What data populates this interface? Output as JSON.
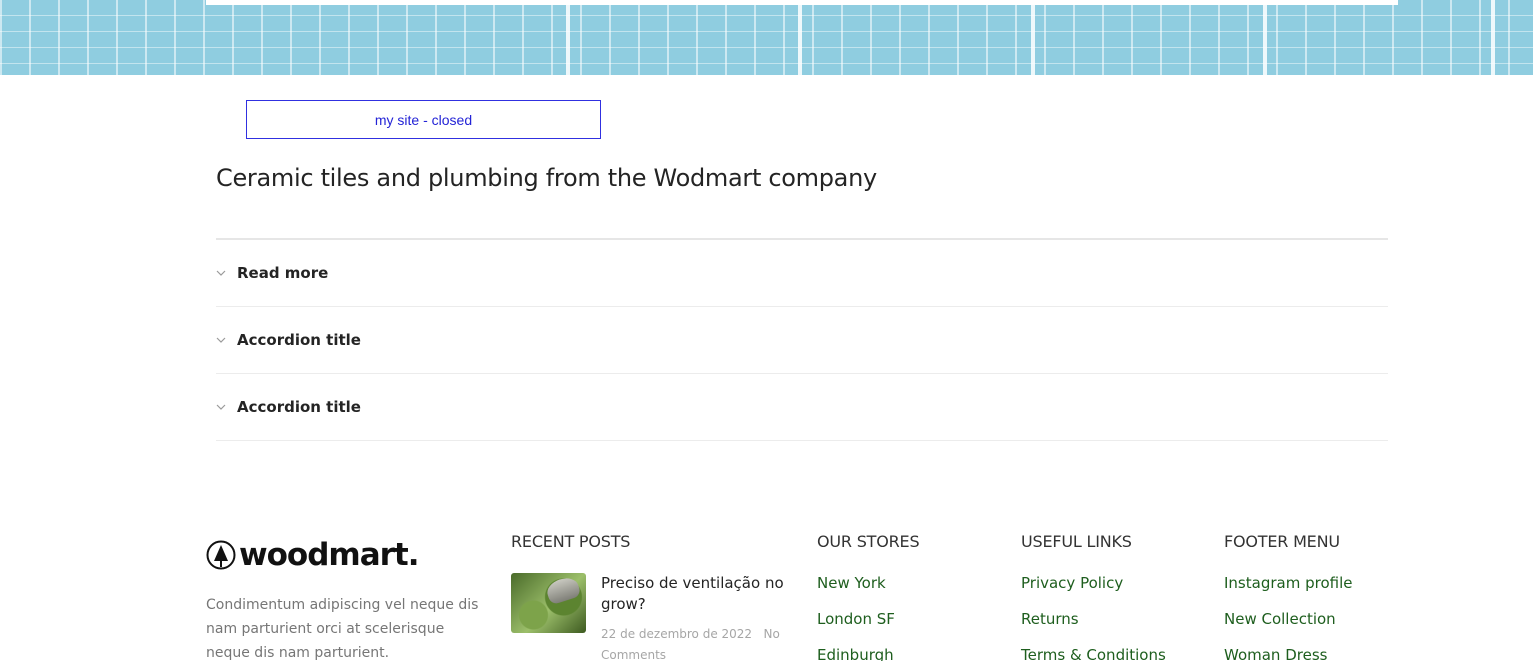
{
  "status_box": {
    "text": "my site - closed"
  },
  "page_title": "Ceramic tiles and plumbing from the Wodmart company",
  "accordion": [
    {
      "label": "Read more"
    },
    {
      "label": "Accordion title"
    },
    {
      "label": "Accordion title"
    }
  ],
  "footer": {
    "logo_text": "woodmart.",
    "about": "Condimentum adipiscing vel neque dis nam parturient orci at scelerisque neque dis nam parturient.",
    "recent_posts": {
      "title": "RECENT POSTS",
      "posts": [
        {
          "title": "Preciso de ventilação no grow?",
          "date": "22 de dezembro de 2022",
          "comments": "No Comments"
        }
      ]
    },
    "our_stores": {
      "title": "OUR STORES",
      "links": [
        "New York",
        "London SF",
        "Edinburgh"
      ]
    },
    "useful_links": {
      "title": "USEFUL LINKS",
      "links": [
        "Privacy Policy",
        "Returns",
        "Terms & Conditions"
      ]
    },
    "footer_menu": {
      "title": "FOOTER MENU",
      "links": [
        "Instagram profile",
        "New Collection",
        "Woman Dress"
      ]
    }
  },
  "colors": {
    "banner": "#8fcde0",
    "status_border": "#3030e0",
    "link_green": "#1e5e1e",
    "heading": "#242424"
  },
  "icons": {
    "accordion": "chevron-down-icon",
    "logo": "tree-in-circle-logo"
  }
}
